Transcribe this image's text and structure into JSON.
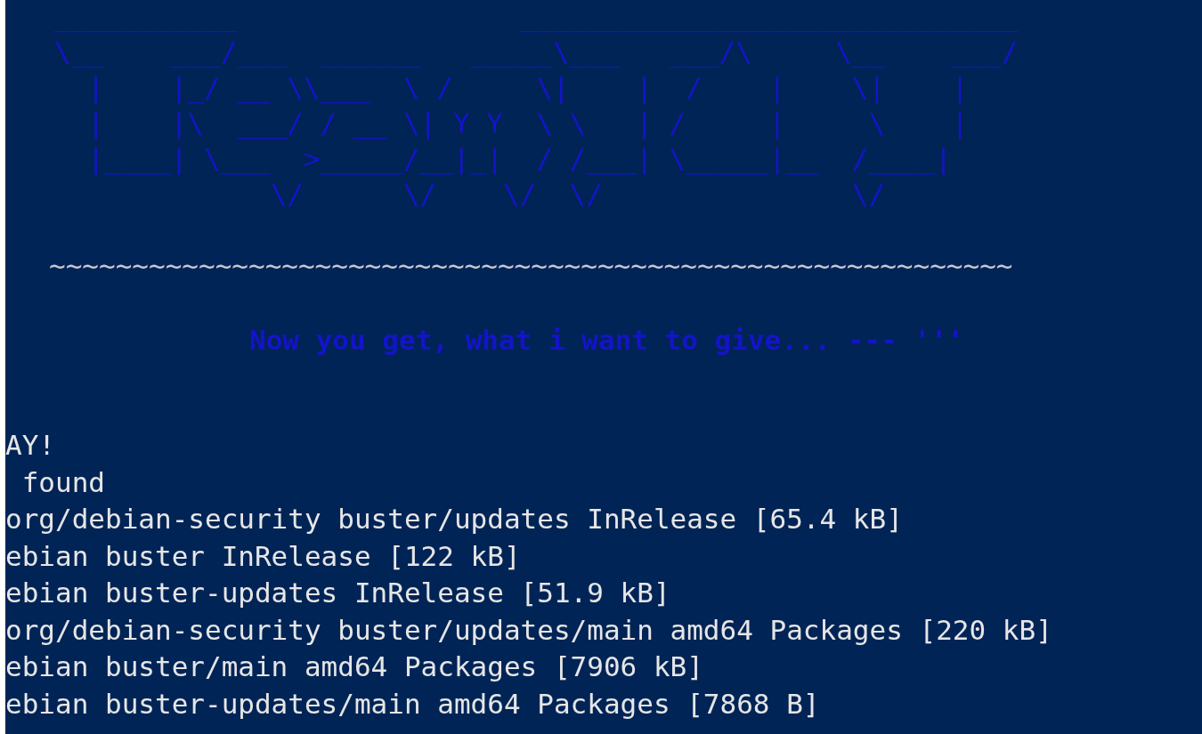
{
  "banner": {
    "art_lines": [
      "___________                 ______________________________",
      "\\__    ___/___  ______   _____\\___   ___/\\     \\__    ___/",
      "  |    |_/ __ \\\\___  \\ /     \\|    |  /    |    \\|    |",
      "  |    |\\  ___/ / __ \\| Y Y  \\ \\   | /     |     \\    |",
      "  |____| \\___  >_____/__|_|  / /___| \\_____|__  /____|",
      "             \\/      \\/    \\/  \\/               \\/"
    ]
  },
  "divider": "~~~~~~~~~~~~~~~~~~~~~~~~~~~~~~~~~~~~~~~~~~~~~~~~~~~~~~~~~~",
  "tagline": "Now you get, what i want to give... --- '''",
  "output_lines": [
    "AY!",
    " found",
    "org/debian-security buster/updates InRelease [65.4 kB]",
    "ebian buster InRelease [122 kB]",
    "ebian buster-updates InRelease [51.9 kB]",
    "org/debian-security buster/updates/main amd64 Packages [220 kB]",
    "ebian buster/main amd64 Packages [7906 kB]",
    "ebian buster-updates/main amd64 Packages [7868 B]"
  ]
}
